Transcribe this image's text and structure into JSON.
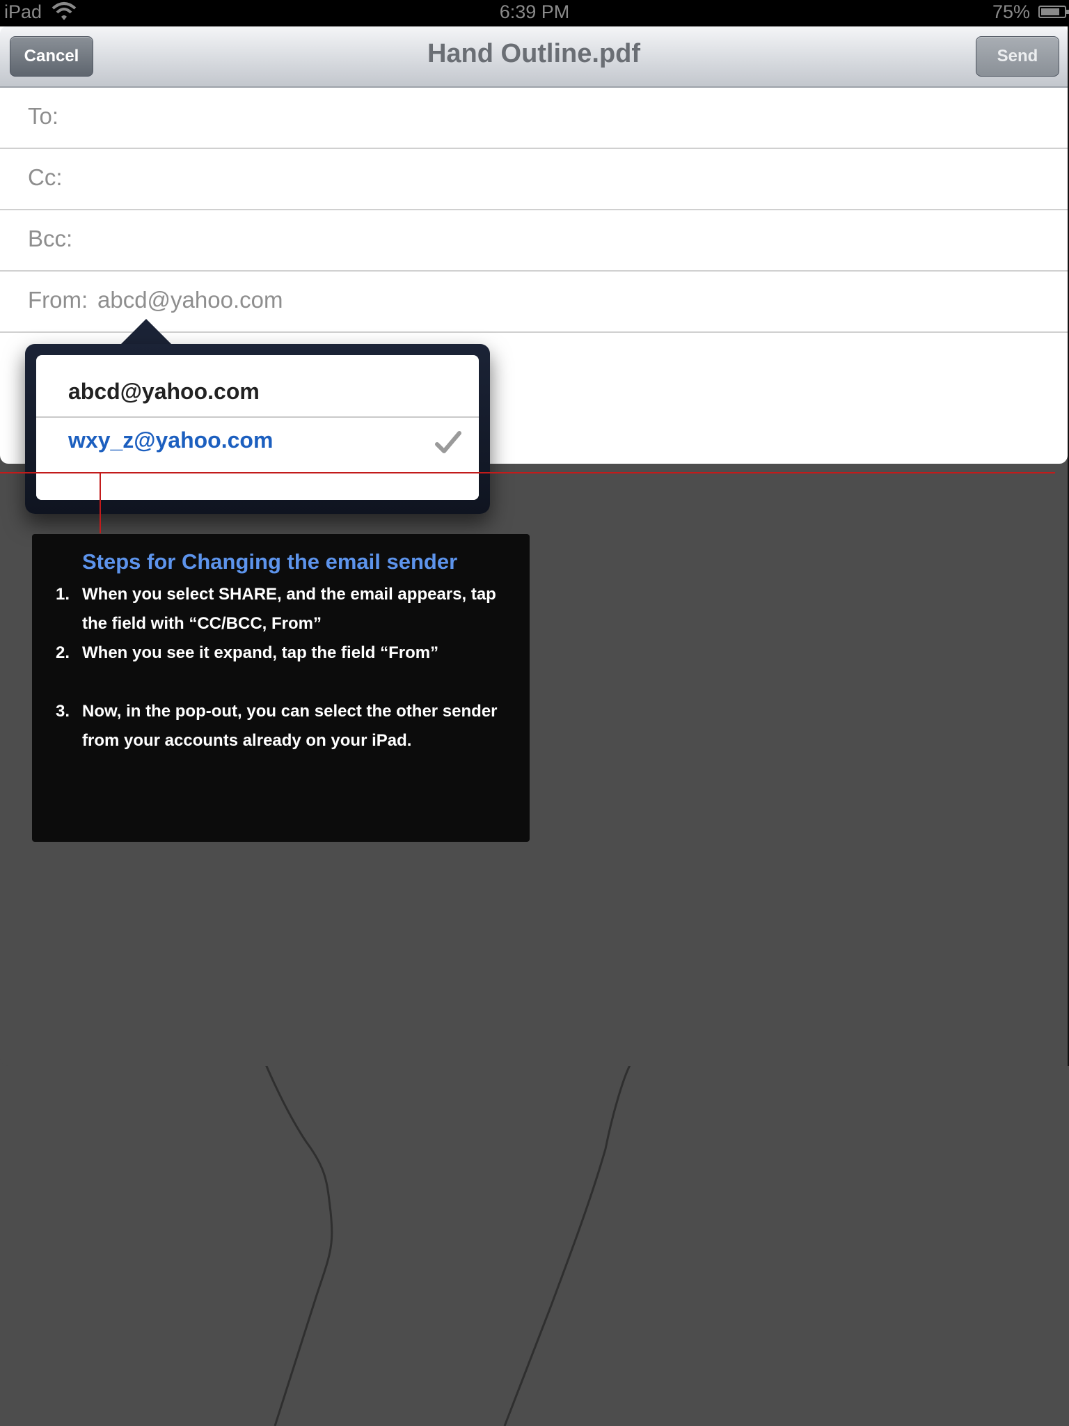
{
  "status_bar": {
    "carrier": "iPad",
    "time": "6:39 PM",
    "battery": "75%",
    "battery_level": 0.75
  },
  "compose": {
    "title": "Hand Outline.pdf",
    "cancel_label": "Cancel",
    "send_label": "Send",
    "to_label": "To:",
    "cc_label": "Cc:",
    "bcc_label": "Bcc:",
    "from_label": "From:",
    "from_value": "abcd@yahoo.com"
  },
  "popover": {
    "accounts": [
      {
        "email": "abcd@yahoo.com",
        "selected": false
      },
      {
        "email": "wxy_z@yahoo.com",
        "selected": true
      }
    ],
    "check_icon": "checkmark-icon"
  },
  "instructions": {
    "title": "Steps for Changing the email sender",
    "steps": [
      {
        "num": "1.",
        "text": "When you select SHARE, and the email appears, tap the field with “CC/BCC, From”"
      },
      {
        "num": "2.",
        "text": "When you see it expand, tap the field “From”"
      },
      {
        "num": "3.",
        "text": "Now, in the pop-out, you can select the other sender from your accounts already on your iPad."
      }
    ]
  },
  "colors": {
    "accent_title": "#5d94ec",
    "selected_account": "#1c5fbf",
    "annotation_line": "#c21b1b"
  }
}
